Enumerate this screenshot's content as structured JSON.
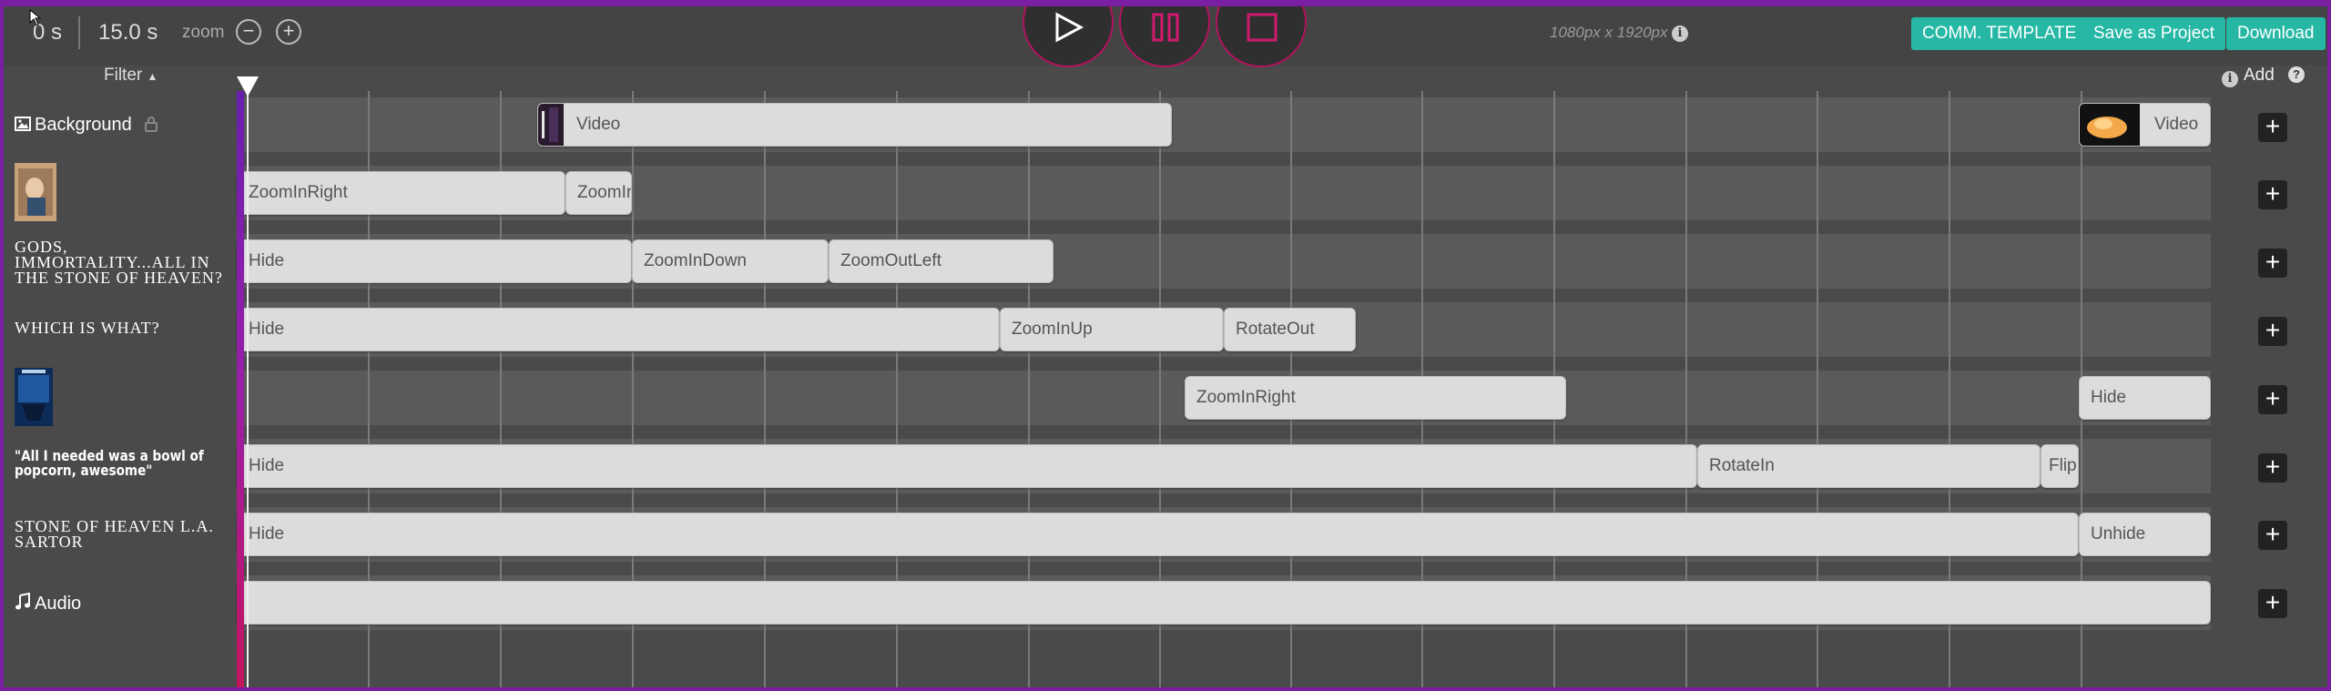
{
  "topbar": {
    "time_current": "0 s",
    "time_total": "15.0 s",
    "zoom_label": "zoom",
    "dimensions": "1080px x 1920px",
    "buttons": {
      "comm_template": "COMM. TEMPLATE",
      "save_project": "Save as Project",
      "download": "Download"
    }
  },
  "toolbar": {
    "filter_label": "Filter",
    "add_label": "Add"
  },
  "tracks": [
    {
      "label": "Background",
      "clips": [
        "Video",
        "Video"
      ]
    },
    {
      "label": "",
      "clips": [
        "ZoomInRight",
        "ZoomIr"
      ]
    },
    {
      "label": "Gods, Immortality...all in the Stone of Heaven?",
      "clips": [
        "Hide",
        "ZoomInDown",
        "ZoomOutLeft"
      ]
    },
    {
      "label": "Which is what?",
      "clips": [
        "Hide",
        "ZoomInUp",
        "RotateOut"
      ]
    },
    {
      "label": "",
      "clips": [
        "ZoomInRight",
        "Hide"
      ]
    },
    {
      "label": "\"All I needed was a bowl of popcorn, awesome\"",
      "clips": [
        "Hide",
        "RotateIn",
        "Flip"
      ]
    },
    {
      "label": "Stone Of Heaven L.A. Sartor",
      "clips": [
        "Hide",
        "Unhide"
      ]
    },
    {
      "label": "Audio",
      "clips": [
        ""
      ]
    }
  ],
  "colors": {
    "accent_teal": "#26b8a4",
    "play_ring": "#b0125f",
    "frame_purple": "#7a1fa2"
  },
  "icons": [
    "play-icon",
    "pause-icon",
    "stop-icon",
    "info-icon",
    "help-icon",
    "image-icon",
    "lock-icon",
    "music-note-icon",
    "plus-icon",
    "zoom-out-icon",
    "zoom-in-icon",
    "caret-up-icon"
  ]
}
